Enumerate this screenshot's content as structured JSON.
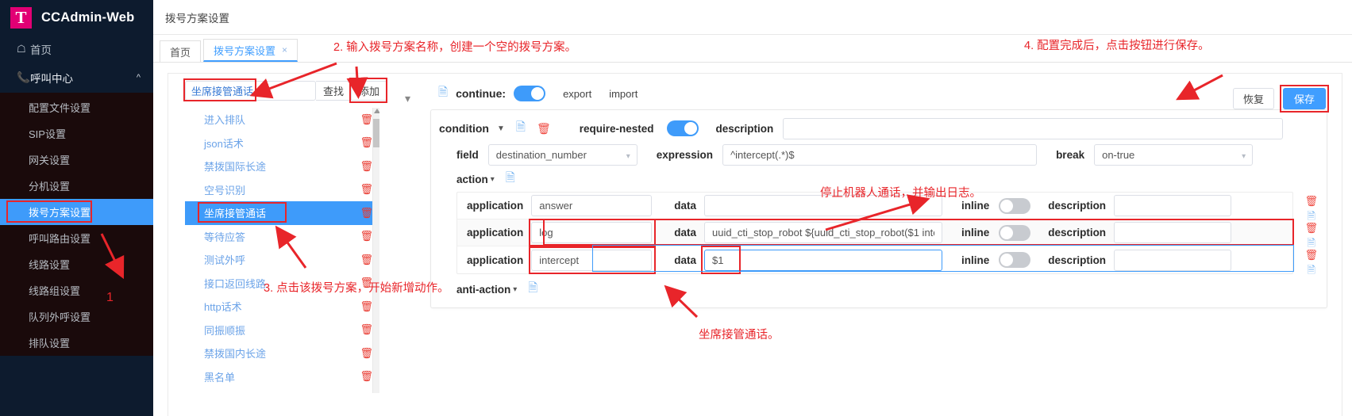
{
  "brand": {
    "logo_letter": "T",
    "title": "CCAdmin-Web"
  },
  "sidebar": {
    "home": {
      "label": "首页",
      "icon": "home-icon"
    },
    "group": {
      "label": "呼叫中心",
      "icon": "phone-icon",
      "chevron": "︿"
    },
    "items": [
      {
        "label": "配置文件设置"
      },
      {
        "label": "SIP设置"
      },
      {
        "label": "网关设置"
      },
      {
        "label": "分机设置"
      },
      {
        "label": "拨号方案设置",
        "active": true
      },
      {
        "label": "呼叫路由设置"
      },
      {
        "label": "线路设置"
      },
      {
        "label": "线路组设置"
      },
      {
        "label": "队列外呼设置"
      },
      {
        "label": "排队设置"
      }
    ]
  },
  "topbar": {
    "title": "拨号方案设置"
  },
  "tabs": [
    {
      "label": "首页",
      "active": false,
      "closable": false
    },
    {
      "label": "拨号方案设置",
      "active": true,
      "closable": true,
      "close": "×"
    }
  ],
  "list_panel": {
    "search_value": "坐席接管通话",
    "search_placeholder": "",
    "find_button": "查找",
    "add_button": "添加",
    "items": [
      {
        "label": "进入排队"
      },
      {
        "label": "json话术"
      },
      {
        "label": "禁拨国际长途"
      },
      {
        "label": "空号识别"
      },
      {
        "label": "坐席接管通话",
        "active": true
      },
      {
        "label": "等待应答"
      },
      {
        "label": "测试外呼"
      },
      {
        "label": "接口返回线路"
      },
      {
        "label": "http话术"
      },
      {
        "label": "同振顺振"
      },
      {
        "label": "禁拨国内长途"
      },
      {
        "label": "黑名单"
      }
    ],
    "delete_icon": "trash-icon"
  },
  "editor": {
    "toolbar": {
      "doc_icon": "file-add-icon",
      "continue_label": "continue:",
      "continue_on": true,
      "export_label": "export",
      "import_label": "import"
    },
    "condition": {
      "title": "condition",
      "caret": "▼",
      "add_icon": "file-add-icon",
      "delete_icon": "trash-icon",
      "require_nested_label": "require-nested",
      "require_nested_on": true,
      "description_label": "description",
      "description_value": "",
      "field_label": "field",
      "field_value": "destination_number",
      "expression_label": "expression",
      "expression_value": "^intercept(.*)$",
      "break_label": "break",
      "break_value": "on-true"
    },
    "action_label": "action",
    "anti_action_label": "anti-action",
    "col_headers": {
      "application": "application",
      "data": "data",
      "inline": "inline",
      "description": "description"
    },
    "actions": [
      {
        "application": "answer",
        "data": "",
        "inline_on": false,
        "description": "",
        "app_highlight": false,
        "row_highlight": false,
        "data_focus": false
      },
      {
        "application": "log",
        "data": "uuid_cti_stop_robot ${uuid_cti_stop_robot($1 inte",
        "inline_on": false,
        "description": "",
        "app_highlight": true,
        "row_highlight": true,
        "data_focus": false
      },
      {
        "application": "intercept",
        "data": "$1",
        "inline_on": false,
        "description": "",
        "app_highlight": true,
        "row_highlight": false,
        "data_focus": true
      }
    ],
    "restore_button": "恢复",
    "save_button": "保存"
  },
  "annotations": {
    "step1": "1",
    "step2": "2. 输入拨号方案名称，创建一个空的拨号方案。",
    "step3": "3. 点击该拨号方案，开始新增动作。",
    "step4": "4. 配置完成后，点击按钮进行保存。",
    "note_stop_robot": "停止机器人通话，并输出日志。",
    "note_takeover": "坐席接管通话。"
  }
}
